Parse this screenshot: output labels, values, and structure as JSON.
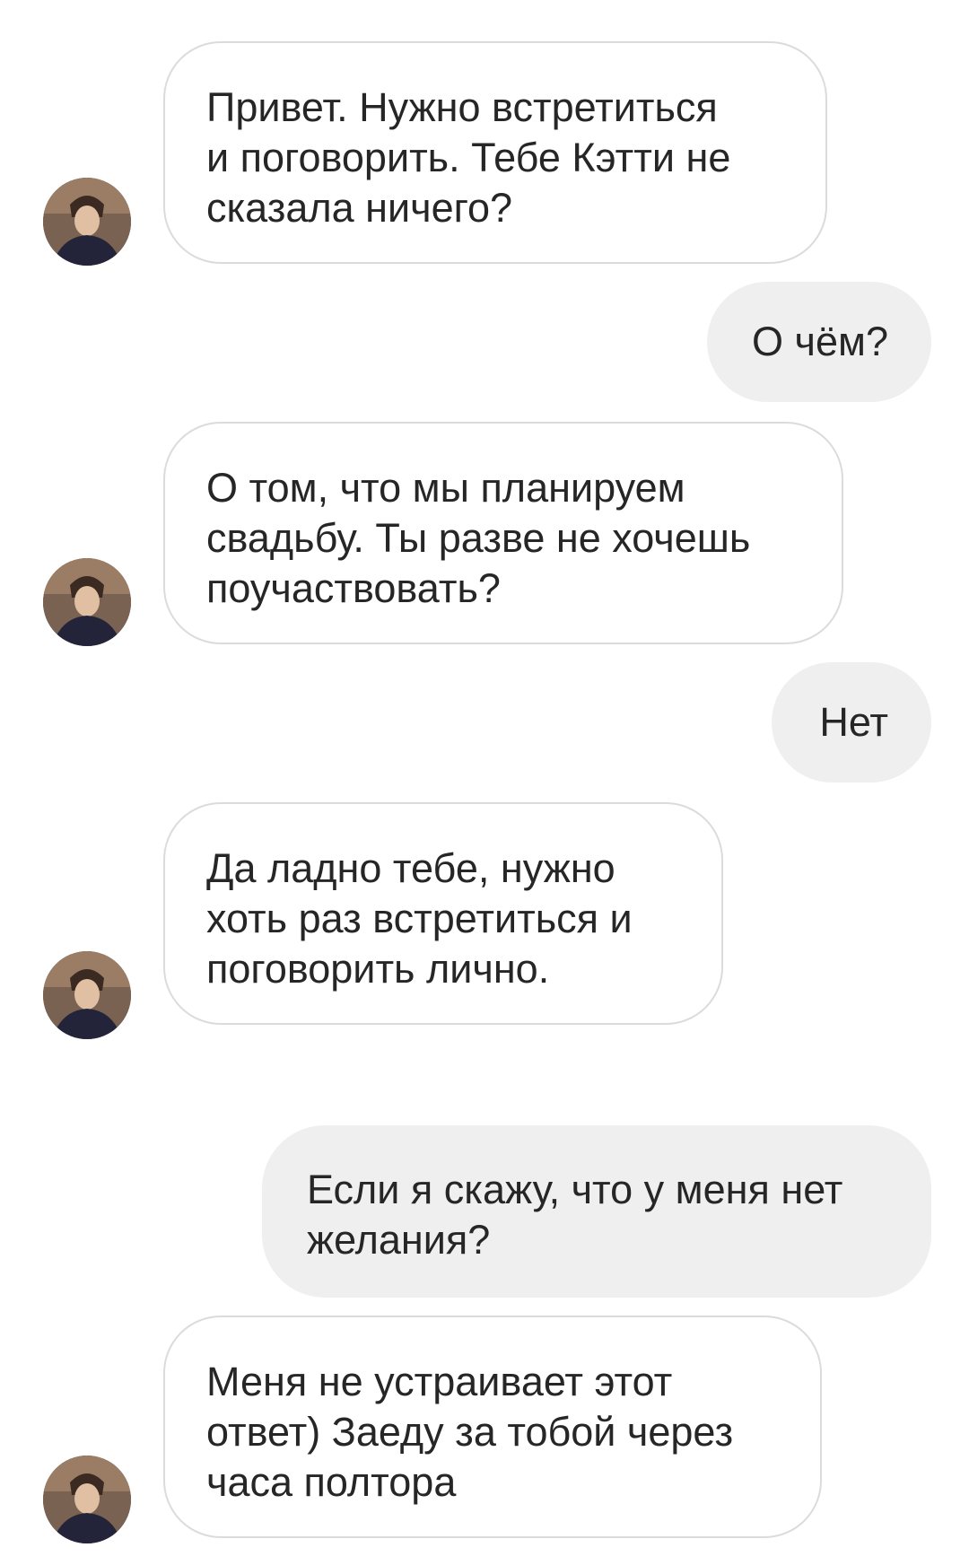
{
  "colors": {
    "incoming_border": "#dbdbdb",
    "outgoing_bg": "#efefef",
    "text": "#262626"
  },
  "messages": [
    {
      "side": "incoming",
      "lines": [
        "Привет. Нужно встретиться",
        "и поговорить. Тебе Кэтти не",
        "сказала ничего?"
      ]
    },
    {
      "side": "outgoing",
      "lines": [
        "О чём?"
      ]
    },
    {
      "side": "incoming",
      "lines": [
        "О том, что мы планируем",
        "свадьбу. Ты разве не хочешь",
        "поучаствовать?"
      ]
    },
    {
      "side": "outgoing",
      "lines": [
        "Нет"
      ]
    },
    {
      "side": "incoming",
      "lines": [
        "Да ладно тебе, нужно",
        "хоть раз встретиться и",
        "поговорить лично."
      ]
    },
    {
      "side": "outgoing",
      "lines": [
        "Если я скажу, что у меня нет",
        "желания?"
      ]
    },
    {
      "side": "incoming",
      "lines": [
        "Меня не устраивает этот",
        "ответ) Заеду за тобой через",
        "часа полтора"
      ]
    }
  ],
  "avatar": {
    "icon": "profile-photo-avatar"
  }
}
